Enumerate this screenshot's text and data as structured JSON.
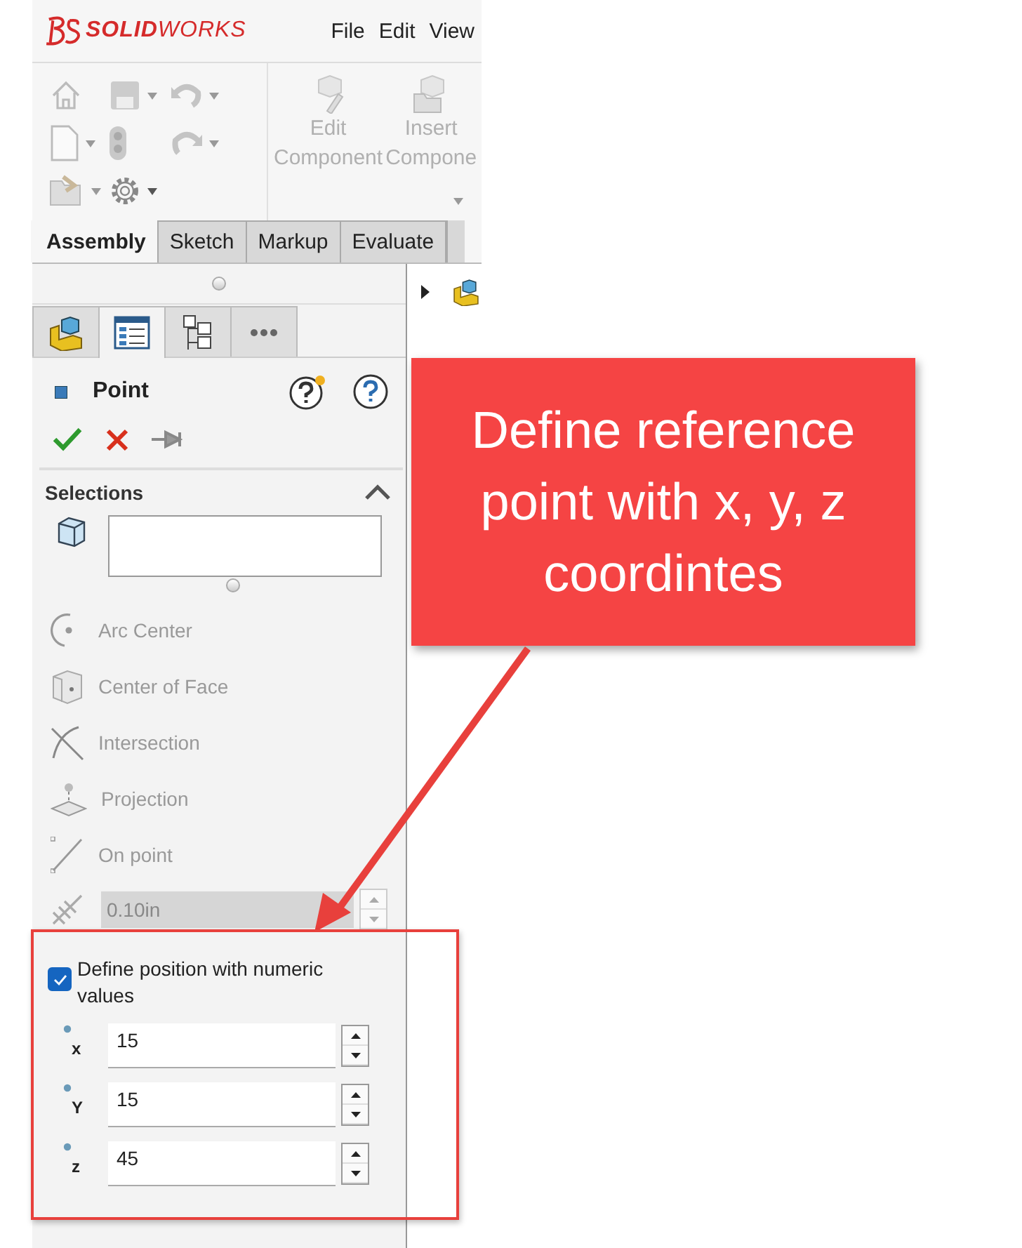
{
  "app": {
    "brand": "**SOLID**WORKS",
    "menu": [
      "File",
      "Edit",
      "View"
    ]
  },
  "toolbar": {
    "big_buttons": [
      {
        "lines": [
          "Edit",
          "Component"
        ],
        "disabled": true
      },
      {
        "lines": [
          "Insert",
          "Compone"
        ],
        "disabled": true
      }
    ]
  },
  "tabs": [
    {
      "label": "Assembly",
      "selected": true
    },
    {
      "label": "Sketch",
      "selected": false
    },
    {
      "label": "Markup",
      "selected": false
    },
    {
      "label": "Evaluate",
      "selected": false
    }
  ],
  "panel_tabs": [
    {
      "kind": "parts",
      "selected": false
    },
    {
      "kind": "property",
      "selected": true
    },
    {
      "kind": "config",
      "selected": false
    },
    {
      "kind": "more",
      "selected": false
    }
  ],
  "property_manager": {
    "title": "Point",
    "section": {
      "title": "Selections",
      "expanded": true
    },
    "options": [
      {
        "kind": "arc",
        "label": "Arc Center",
        "disabled": true
      },
      {
        "kind": "face",
        "label": "Center of Face",
        "disabled": true
      },
      {
        "kind": "intersection",
        "label": "Intersection",
        "disabled": true
      },
      {
        "kind": "projection",
        "label": "Projection",
        "disabled": true
      },
      {
        "kind": "onpoint",
        "label": "On point",
        "disabled": true
      }
    ],
    "distance": {
      "value": "0.10in",
      "disabled": true
    },
    "numeric": {
      "label": "Define position with numeric values",
      "checked": true
    },
    "coordinates": [
      {
        "axis": "x",
        "value": "15"
      },
      {
        "axis": "Y",
        "value": "15"
      },
      {
        "axis": "z",
        "value": "45"
      }
    ]
  },
  "annotation": {
    "text": "Define reference point with x, y, z coordintes"
  }
}
